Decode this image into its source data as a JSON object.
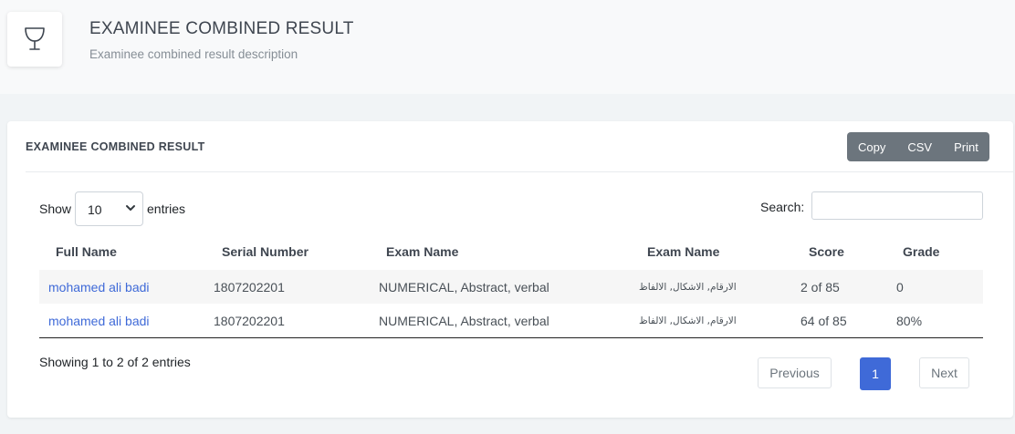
{
  "header": {
    "icon": "trophy-icon",
    "title": "EXAMINEE COMBINED RESULT",
    "subtitle": "Examinee combined result description"
  },
  "card": {
    "title": "EXAMINEE COMBINED RESULT",
    "buttons": {
      "copy": "Copy",
      "csv": "CSV",
      "print": "Print"
    }
  },
  "controls": {
    "show_label": "Show",
    "length_value": "10",
    "entries_label": "entries",
    "search_label": "Search:",
    "search_value": ""
  },
  "table": {
    "columns": [
      "Full Name",
      "Serial Number",
      "Exam Name",
      "Exam Name",
      "Score",
      "Grade"
    ],
    "rows": [
      {
        "full_name": "mohamed ali badi",
        "serial": "1807202201",
        "exam_en": "NUMERICAL, Abstract, verbal",
        "exam_ar": "الارقام, الاشكال, الالفاظ",
        "score": "2 of 85",
        "grade": "0"
      },
      {
        "full_name": "mohamed ali badi",
        "serial": "1807202201",
        "exam_en": "NUMERICAL, Abstract, verbal",
        "exam_ar": "الارقام, الاشكال, الالفاظ",
        "score": "64 of 85",
        "grade": "80%"
      }
    ]
  },
  "footer": {
    "info": "Showing 1 to 2 of 2 entries",
    "previous": "Previous",
    "page": "1",
    "next": "Next"
  },
  "colors": {
    "accent": "#3f6ad8",
    "button_group": "#6c757d"
  }
}
